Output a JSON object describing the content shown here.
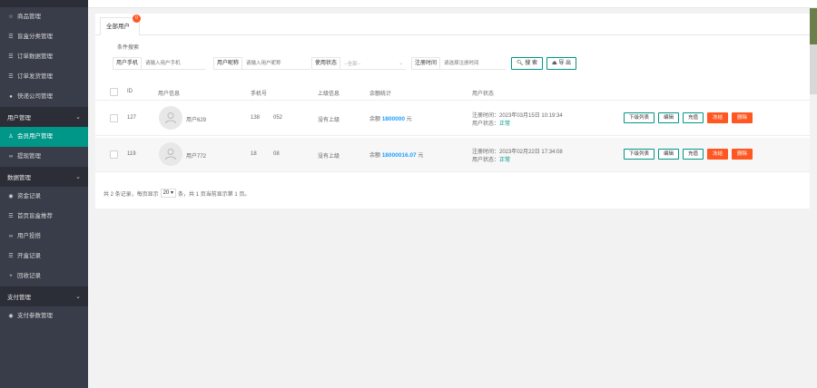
{
  "sidebar": {
    "items_top": [
      {
        "label": "商品管理",
        "icon": "star-icon"
      },
      {
        "label": "盲盒分类管理",
        "icon": "list-icon"
      },
      {
        "label": "订单数据管理",
        "icon": "list-icon"
      },
      {
        "label": "订单发货管理",
        "icon": "list-icon"
      },
      {
        "label": "快递公司管理",
        "icon": "globe-icon"
      }
    ],
    "group_user": "用户管理",
    "items_user": [
      {
        "label": "会员用户管理",
        "icon": "user-icon",
        "active": true
      },
      {
        "label": "提现管理",
        "icon": "link-icon"
      }
    ],
    "group_data": "数据管理",
    "items_data": [
      {
        "label": "资金记录",
        "icon": "circle-dot-icon"
      },
      {
        "label": "首页盲盒推荐",
        "icon": "list-icon"
      },
      {
        "label": "用户投搭",
        "icon": "link-icon"
      },
      {
        "label": "开盒记录",
        "icon": "list-icon"
      },
      {
        "label": "回收记录",
        "icon": "plus-icon"
      }
    ],
    "group_pay": "支付管理",
    "items_pay": [
      {
        "label": "支付参数管理",
        "icon": "circle-dot-icon"
      }
    ]
  },
  "tabs": [
    {
      "label": "全部用户",
      "badge": "0"
    }
  ],
  "filter": {
    "title": "条件搜索",
    "phone_label": "用户手机",
    "phone_placeholder": "请输入用户手机",
    "nick_label": "用户昵称",
    "nick_placeholder": "请输入用户昵称",
    "status_label": "使用状态",
    "status_value": "--全部--",
    "time_label": "注册时间",
    "time_placeholder": "请选择注册时间",
    "search_btn": "搜 索",
    "export_btn": "导 出"
  },
  "table": {
    "headers": [
      "ID",
      "用户信息",
      "手机号",
      "上级信息",
      "余额统计",
      "用户状态"
    ],
    "rows": [
      {
        "id": "127",
        "name": "用户629",
        "phone_a": "138",
        "phone_b": "052",
        "parent": "没有上级",
        "balance_label": "余额",
        "balance": "1800000",
        "unit": "元",
        "reg_time": "注册时间：2023年03月15日 10:19:34",
        "status_label": "用户状态：",
        "status": "正常",
        "actions": [
          "下级列表",
          "编辑",
          "充值",
          "冻结",
          "删除"
        ]
      },
      {
        "id": "119",
        "name": "用户772",
        "phone_a": "18",
        "phone_b": "08",
        "parent": "没有上级",
        "balance_label": "余额",
        "balance": "18000016.07",
        "unit": "元",
        "reg_time": "注册时间：2023年02月22日 17:34:08",
        "status_label": "用户状态：",
        "status": "正常",
        "actions": [
          "下级列表",
          "编辑",
          "充值",
          "冻结",
          "删除"
        ]
      }
    ]
  },
  "pager": {
    "text_a": "共 2 条记录，每页显示",
    "page_size": "20",
    "text_b": "条，共 1 页当前显示第 1 页。"
  }
}
